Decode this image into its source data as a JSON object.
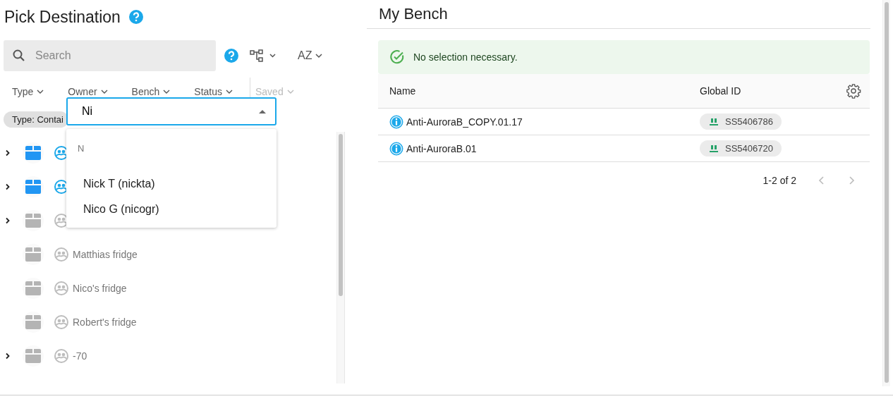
{
  "title": "Pick Destination",
  "search": {
    "placeholder": "Search"
  },
  "sort_label": "AZ",
  "filters": [
    {
      "label": "Type",
      "disabled": false
    },
    {
      "label": "Owner",
      "disabled": false
    },
    {
      "label": "Bench",
      "disabled": false
    },
    {
      "label": "Status",
      "disabled": false
    },
    {
      "label": "Saved",
      "disabled": true
    }
  ],
  "chips": [
    {
      "label": "Type: Contai"
    }
  ],
  "owner_dropdown": {
    "value": "Ni",
    "group": "N",
    "options": [
      "Nick T (nickta)",
      "Nico G (nicogr)"
    ]
  },
  "tree": [
    {
      "expandable": true,
      "active": true
    },
    {
      "expandable": true,
      "active": true
    },
    {
      "expandable": true,
      "active": false
    },
    {
      "label": "Matthias fridge",
      "expandable": false,
      "active": false
    },
    {
      "label": "Nico's fridge",
      "expandable": false,
      "active": false
    },
    {
      "label": "Robert's fridge",
      "expandable": false,
      "active": false
    },
    {
      "label": "-70",
      "expandable": true,
      "active": false
    }
  ],
  "bench": {
    "title": "My Bench",
    "alert": "No selection necessary.",
    "columns": [
      "Name",
      "Global ID"
    ],
    "rows": [
      {
        "name": "Anti-AuroraB_COPY.01.17",
        "global_id": "SS5406786"
      },
      {
        "name": "Anti-AuroraB.01",
        "global_id": "SS5406720"
      }
    ],
    "pagination": "1-2 of 2"
  }
}
